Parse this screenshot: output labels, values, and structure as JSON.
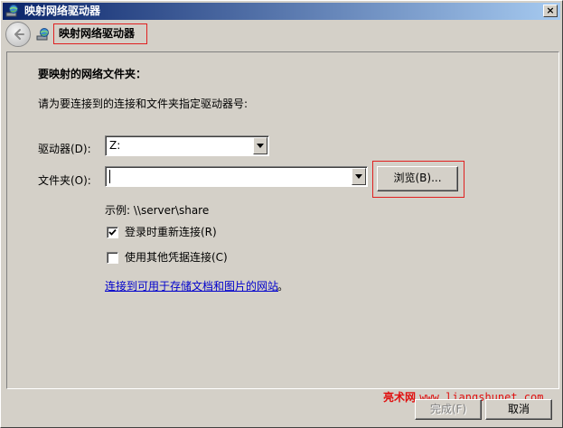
{
  "window": {
    "title": "映射网络驱动器",
    "close_label": "×"
  },
  "nav": {
    "title": "映射网络驱动器"
  },
  "main": {
    "heading": "要映射的网络文件夹：",
    "instruction": "请为要连接到的连接和文件夹指定驱动器号:",
    "drive_label": "驱动器(D):",
    "drive_value": "Z:",
    "folder_label": "文件夹(O):",
    "folder_value": "",
    "browse_label": "浏览(B)...",
    "example": "示例: \\\\server\\share",
    "reconnect_label": "登录时重新连接(R)",
    "reconnect_checked": true,
    "other_credentials_label": "使用其他凭据连接(C)",
    "other_credentials_checked": false,
    "link_text": "连接到可用于存储文档和图片的网站",
    "link_suffix": "。"
  },
  "footer": {
    "watermark_brand": "亮术网",
    "watermark_url": "www.liangshunet.com",
    "finish_label": "完成(F)",
    "cancel_label": "取消"
  },
  "colors": {
    "highlight_border": "#e02020",
    "link": "#0000cc",
    "watermark": "#e01010",
    "dialog_bg": "#d4d0c8"
  },
  "icons": {
    "title_icon": "network-drive-icon",
    "back_icon": "back-arrow-icon",
    "nav_icon": "network-drive-icon"
  }
}
